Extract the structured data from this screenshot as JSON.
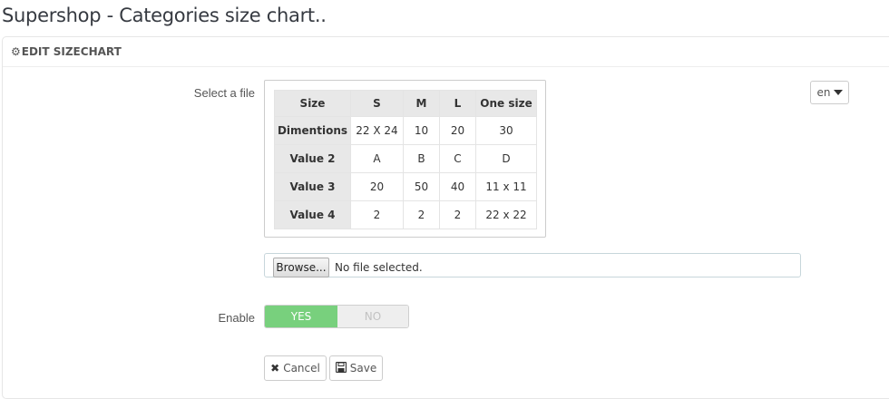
{
  "page": {
    "title": "Supershop - Categories size chart.."
  },
  "panel": {
    "heading": "EDIT SIZECHART",
    "heading_icon": "gear-icon"
  },
  "form": {
    "select_file_label": "Select a file",
    "enable_label": "Enable"
  },
  "sizechart": {
    "header": [
      "Size",
      "S",
      "M",
      "L",
      "One size"
    ],
    "rows": [
      [
        "Dimentions",
        "22 X 24",
        "10",
        "20",
        "30"
      ],
      [
        "Value 2",
        "A",
        "B",
        "C",
        "D"
      ],
      [
        "Value 3",
        "20",
        "50",
        "40",
        "11 x 11"
      ],
      [
        "Value 4",
        "2",
        "2",
        "2",
        "22 x 22"
      ]
    ]
  },
  "language": {
    "selected": "en"
  },
  "file_input": {
    "browse_label": "Browse...",
    "status": "No file selected."
  },
  "enable_switch": {
    "yes_label": "YES",
    "no_label": "NO",
    "selected": "YES",
    "on_color": "#78d07d"
  },
  "actions": {
    "cancel_label": "Cancel",
    "save_label": "Save"
  }
}
